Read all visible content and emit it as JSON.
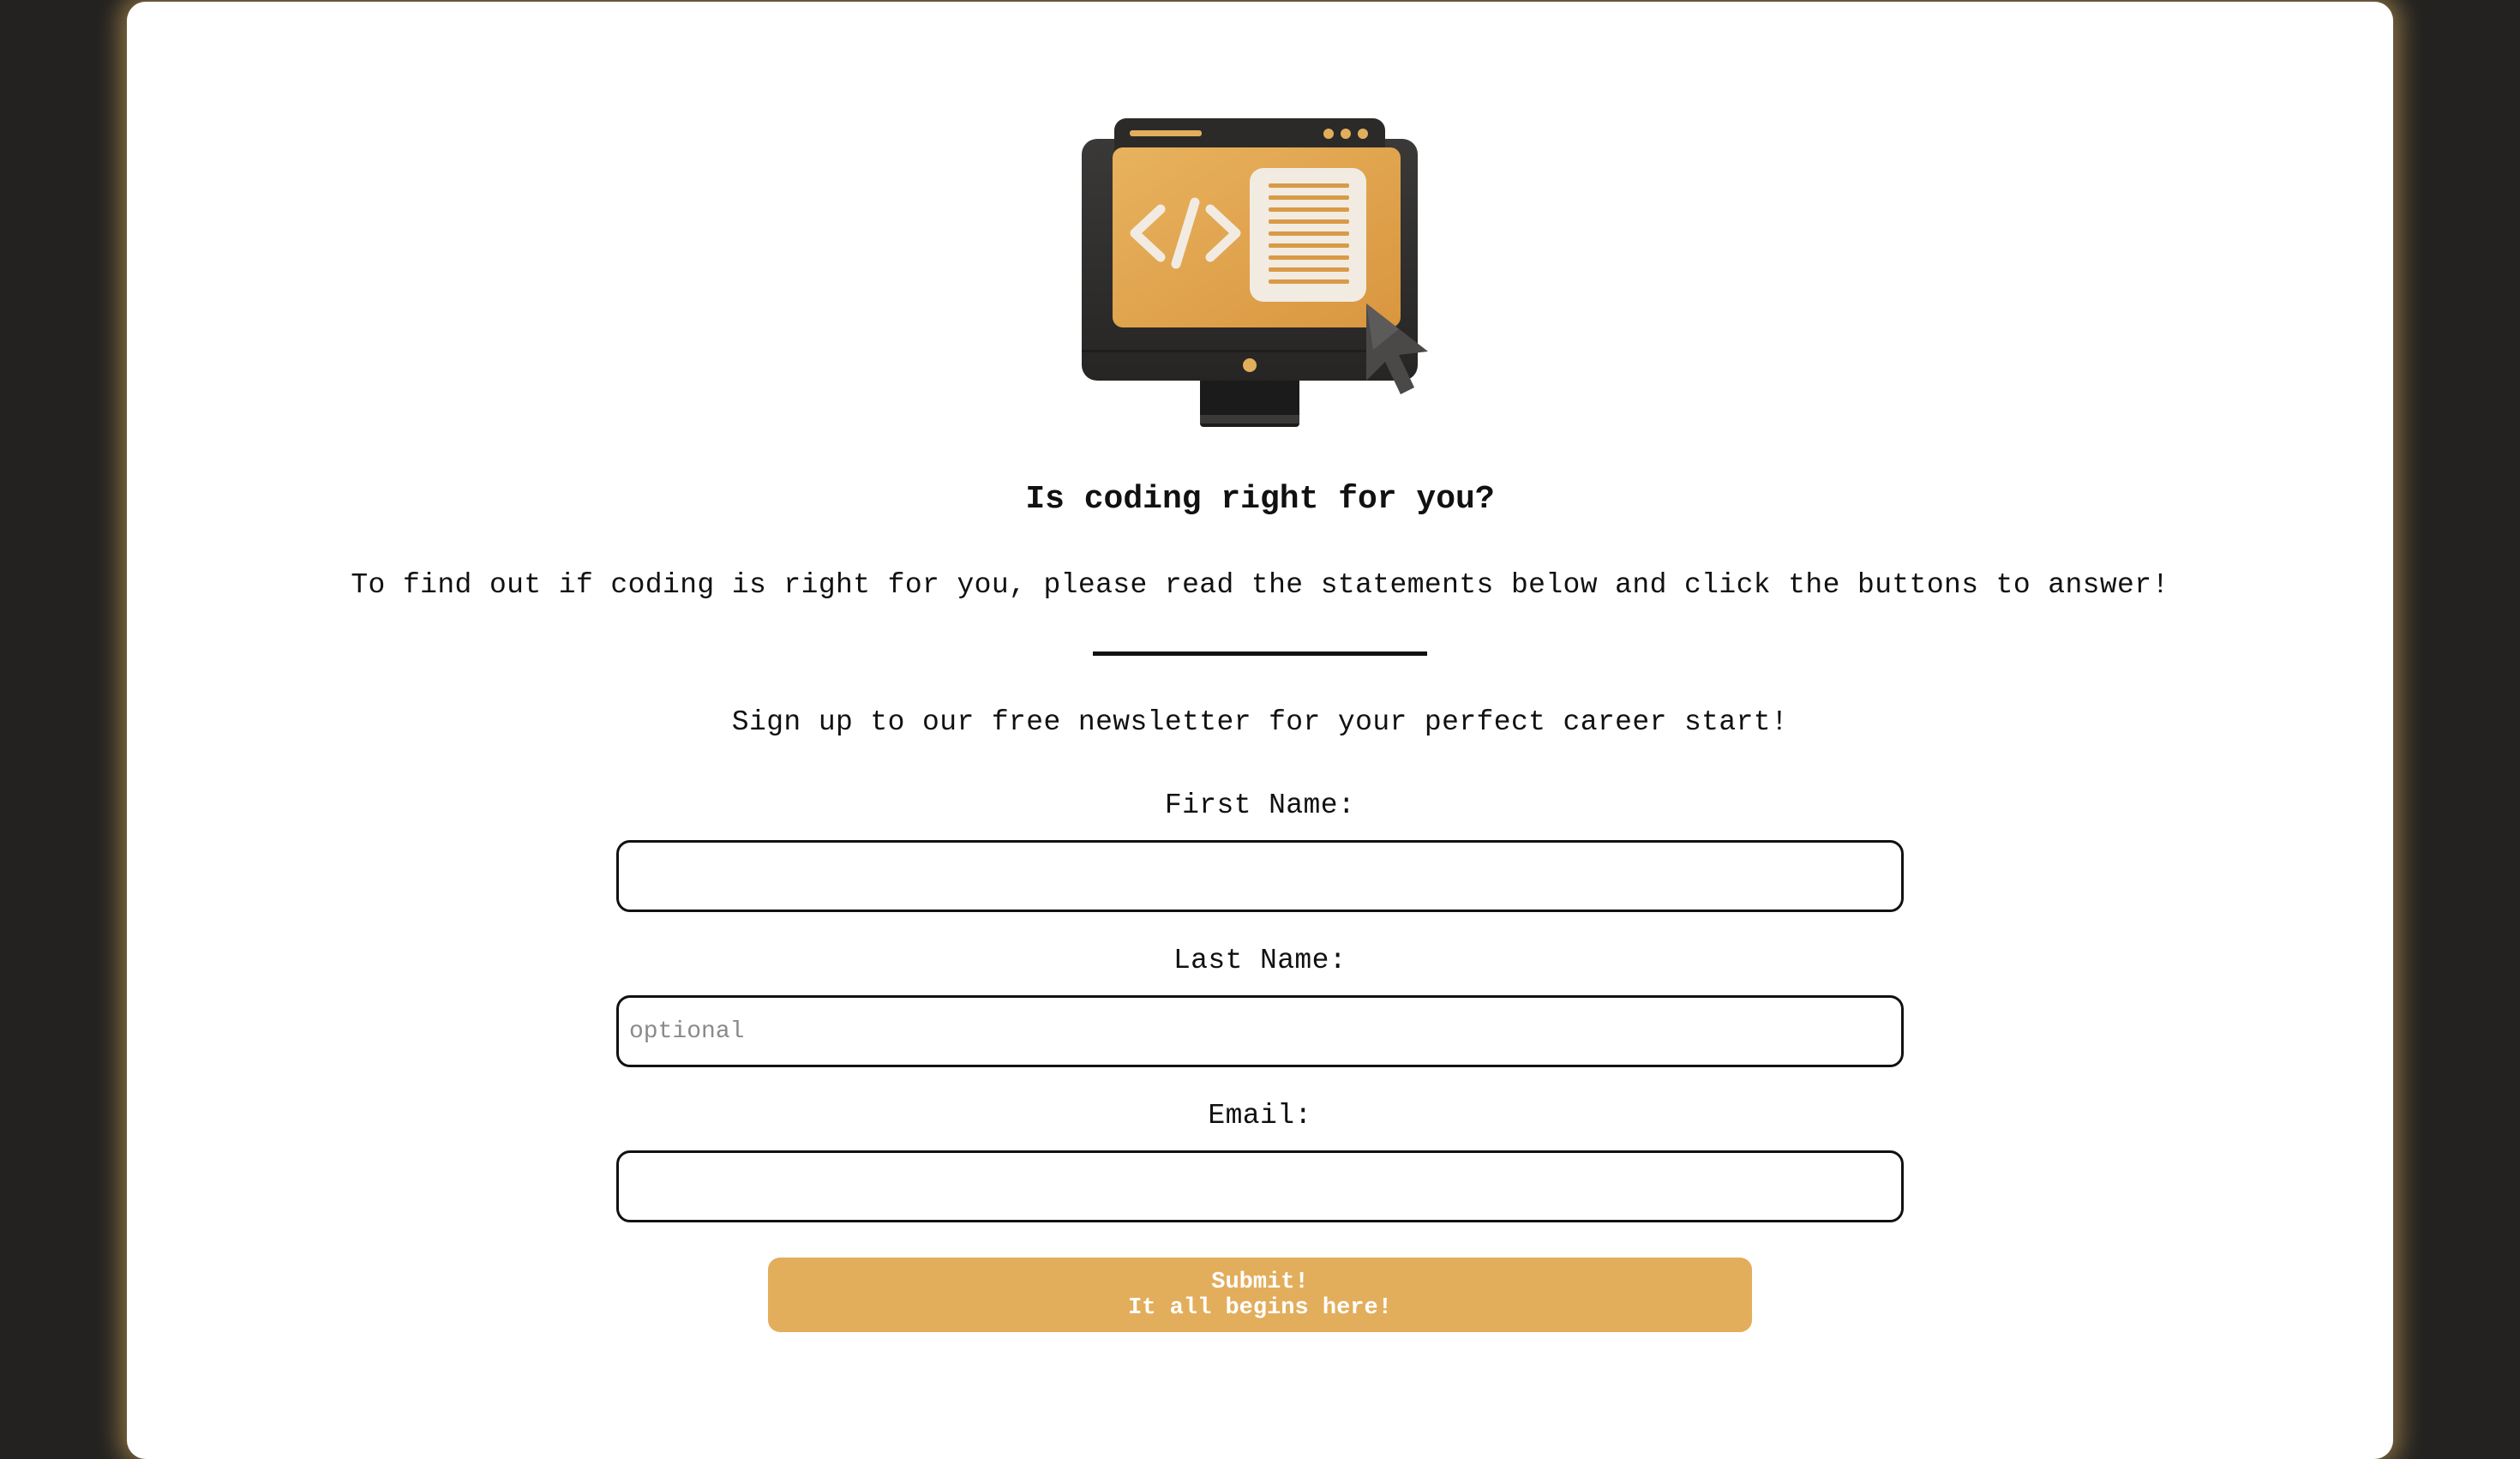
{
  "hero": {
    "image_name": "computer-code-illustration",
    "colors": {
      "accent": "#e2ae5c",
      "frame": "#2f2e2d",
      "paper": "#f2ebe2"
    }
  },
  "heading": "Is coding right for you?",
  "intro": "To find out if coding is right for you, please read the statements below and click the buttons to answer!",
  "newsletter": "Sign up to our free newsletter for your perfect career start!",
  "form": {
    "first_name": {
      "label": "First Name:",
      "value": "",
      "placeholder": ""
    },
    "last_name": {
      "label": "Last Name:",
      "value": "",
      "placeholder": "optional"
    },
    "email": {
      "label": "Email:",
      "value": "",
      "placeholder": ""
    },
    "submit": {
      "line1": "Submit!",
      "line2": "It all begins here!"
    }
  },
  "theme": {
    "background": "#232220",
    "card": "#ffffff",
    "glow": "#cea35a",
    "button": "#e2ae5c"
  }
}
